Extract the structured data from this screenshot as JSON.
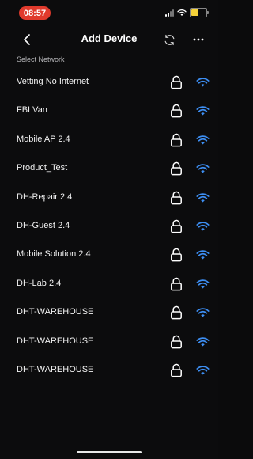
{
  "status_bar": {
    "time": "08:57"
  },
  "header": {
    "title": "Add Device"
  },
  "section_label": "Select Network",
  "networks": [
    {
      "name": "Vetting No Internet"
    },
    {
      "name": "FBI Van"
    },
    {
      "name": "Mobile AP 2.4"
    },
    {
      "name": "Product_Test"
    },
    {
      "name": "DH-Repair 2.4"
    },
    {
      "name": "DH-Guest 2.4"
    },
    {
      "name": "Mobile Solution 2.4"
    },
    {
      "name": "DH-Lab 2.4"
    },
    {
      "name": "DHT-WAREHOUSE"
    },
    {
      "name": "DHT-WAREHOUSE"
    },
    {
      "name": "DHT-WAREHOUSE"
    }
  ],
  "colors": {
    "wifi": "#3d8ef2",
    "time_pill": "#e03a2c",
    "background": "#0c0c0d",
    "battery": "#f6d33a"
  },
  "icons": {
    "back": "chevron-left-icon",
    "refresh": "refresh-icon",
    "more": "more-icon",
    "lock": "lock-icon",
    "wifi": "wifi-icon"
  }
}
